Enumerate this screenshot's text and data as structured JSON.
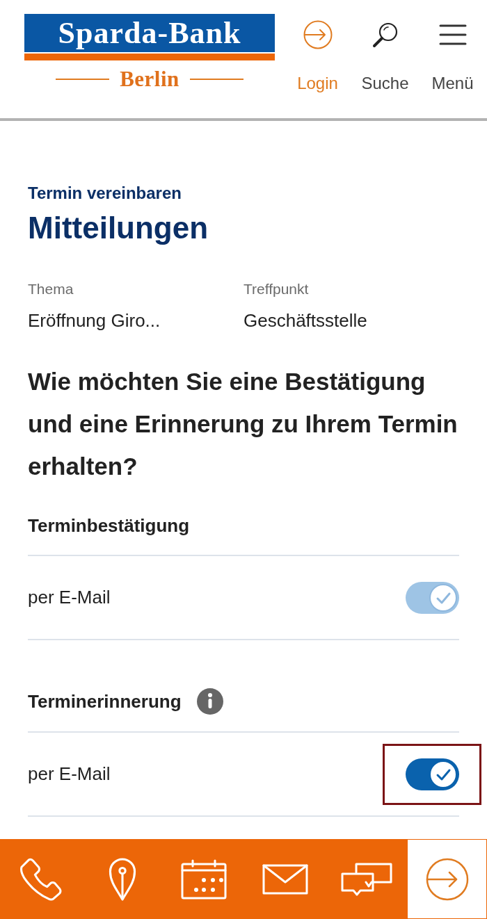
{
  "header": {
    "logo": {
      "wordmark": "Sparda-Bank",
      "region": "Berlin"
    },
    "actions": [
      {
        "kind": "login",
        "label": "Login"
      },
      {
        "kind": "search",
        "label": "Suche"
      },
      {
        "kind": "menu",
        "label": "Menü"
      }
    ]
  },
  "page": {
    "breadcrumb": "Termin vereinbaren",
    "title": "Mitteilungen"
  },
  "summary": [
    {
      "label": "Thema",
      "value": "Eröffnung Giro..."
    },
    {
      "label": "Treffpunkt",
      "value": "Geschäftsstelle"
    }
  ],
  "question": "Wie möchten Sie eine Bestätigung und eine Erinnerung zu Ihrem Termin erhalten?",
  "sections": [
    {
      "title": "Terminbestätigung",
      "info": false,
      "options": [
        {
          "label": "per E-Mail",
          "checked": true,
          "disabled": true,
          "highlighted": false
        }
      ]
    },
    {
      "title": "Terminerinnerung",
      "info": true,
      "options": [
        {
          "label": "per E-Mail",
          "checked": true,
          "disabled": false,
          "highlighted": true
        }
      ]
    }
  ],
  "bottom_bar": [
    {
      "kind": "phone"
    },
    {
      "kind": "location"
    },
    {
      "kind": "calendar"
    },
    {
      "kind": "mail"
    },
    {
      "kind": "chat"
    },
    {
      "kind": "login"
    }
  ]
}
